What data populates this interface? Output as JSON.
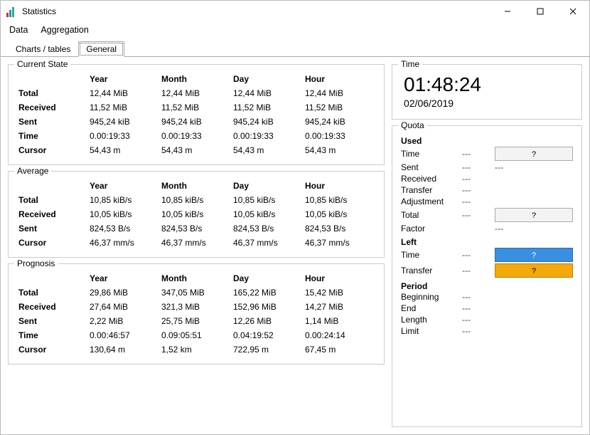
{
  "window": {
    "title": "Statistics"
  },
  "menu": {
    "data": "Data",
    "aggregation": "Aggregation"
  },
  "tabs": {
    "charts": "Charts / tables",
    "general": "General"
  },
  "columns": {
    "year": "Year",
    "month": "Month",
    "day": "Day",
    "hour": "Hour"
  },
  "current": {
    "title": "Current State",
    "rows": {
      "total": {
        "label": "Total",
        "y": "12,44 MiB",
        "m": "12,44 MiB",
        "d": "12,44 MiB",
        "h": "12,44 MiB"
      },
      "received": {
        "label": "Received",
        "y": "11,52 MiB",
        "m": "11,52 MiB",
        "d": "11,52 MiB",
        "h": "11,52 MiB"
      },
      "sent": {
        "label": "Sent",
        "y": "945,24 kiB",
        "m": "945,24 kiB",
        "d": "945,24 kiB",
        "h": "945,24 kiB"
      },
      "time": {
        "label": "Time",
        "y": "0.00:19:33",
        "m": "0.00:19:33",
        "d": "0.00:19:33",
        "h": "0.00:19:33"
      },
      "cursor": {
        "label": "Cursor",
        "y": "54,43 m",
        "m": "54,43 m",
        "d": "54,43 m",
        "h": "54,43 m"
      }
    }
  },
  "average": {
    "title": "Average",
    "rows": {
      "total": {
        "label": "Total",
        "y": "10,85 kiB/s",
        "m": "10,85 kiB/s",
        "d": "10,85 kiB/s",
        "h": "10,85 kiB/s"
      },
      "received": {
        "label": "Received",
        "y": "10,05 kiB/s",
        "m": "10,05 kiB/s",
        "d": "10,05 kiB/s",
        "h": "10,05 kiB/s"
      },
      "sent": {
        "label": "Sent",
        "y": "824,53 B/s",
        "m": "824,53 B/s",
        "d": "824,53 B/s",
        "h": "824,53 B/s"
      },
      "cursor": {
        "label": "Cursor",
        "y": "46,37 mm/s",
        "m": "46,37 mm/s",
        "d": "46,37 mm/s",
        "h": "46,37 mm/s"
      }
    }
  },
  "prognosis": {
    "title": "Prognosis",
    "rows": {
      "total": {
        "label": "Total",
        "y": "29,86 MiB",
        "m": "347,05 MiB",
        "d": "165,22 MiB",
        "h": "15,42 MiB"
      },
      "received": {
        "label": "Received",
        "y": "27,64 MiB",
        "m": "321,3 MiB",
        "d": "152,96 MiB",
        "h": "14,27 MiB"
      },
      "sent": {
        "label": "Sent",
        "y": "2,22 MiB",
        "m": "25,75 MiB",
        "d": "12,26 MiB",
        "h": "1,14 MiB"
      },
      "time": {
        "label": "Time",
        "y": "0.00:46:57",
        "m": "0.09:05:51",
        "d": "0.04:19:52",
        "h": "0.00:24:14"
      },
      "cursor": {
        "label": "Cursor",
        "y": "130,64 m",
        "m": "1,52 km",
        "d": "722,95 m",
        "h": "67,45 m"
      }
    }
  },
  "time": {
    "title": "Time",
    "value": "01:48:24",
    "date": "02/06/2019"
  },
  "quota": {
    "title": "Quota",
    "used": {
      "header": "Used",
      "time": {
        "label": "Time",
        "val": "---",
        "btn": "?"
      },
      "sent": {
        "label": "Sent",
        "val": "---",
        "extra": "---"
      },
      "received": {
        "label": "Received",
        "val": "---"
      },
      "transfer": {
        "label": "Transfer",
        "val": "---"
      },
      "adjustment": {
        "label": "Adjustment",
        "val": "---"
      },
      "total": {
        "label": "Total",
        "val": "---",
        "btn": "?"
      },
      "factor": {
        "label": "Factor",
        "val": "",
        "extra": "---"
      }
    },
    "left": {
      "header": "Left",
      "time": {
        "label": "Time",
        "val": "---",
        "btn": "?"
      },
      "transfer": {
        "label": "Transfer",
        "val": "---",
        "btn": "?"
      }
    },
    "period": {
      "header": "Period",
      "beginning": {
        "label": "Beginning",
        "val": "---"
      },
      "end": {
        "label": "End",
        "val": "---"
      },
      "length": {
        "label": "Length",
        "val": "---"
      },
      "limit": {
        "label": "Limit",
        "val": "---"
      }
    }
  }
}
